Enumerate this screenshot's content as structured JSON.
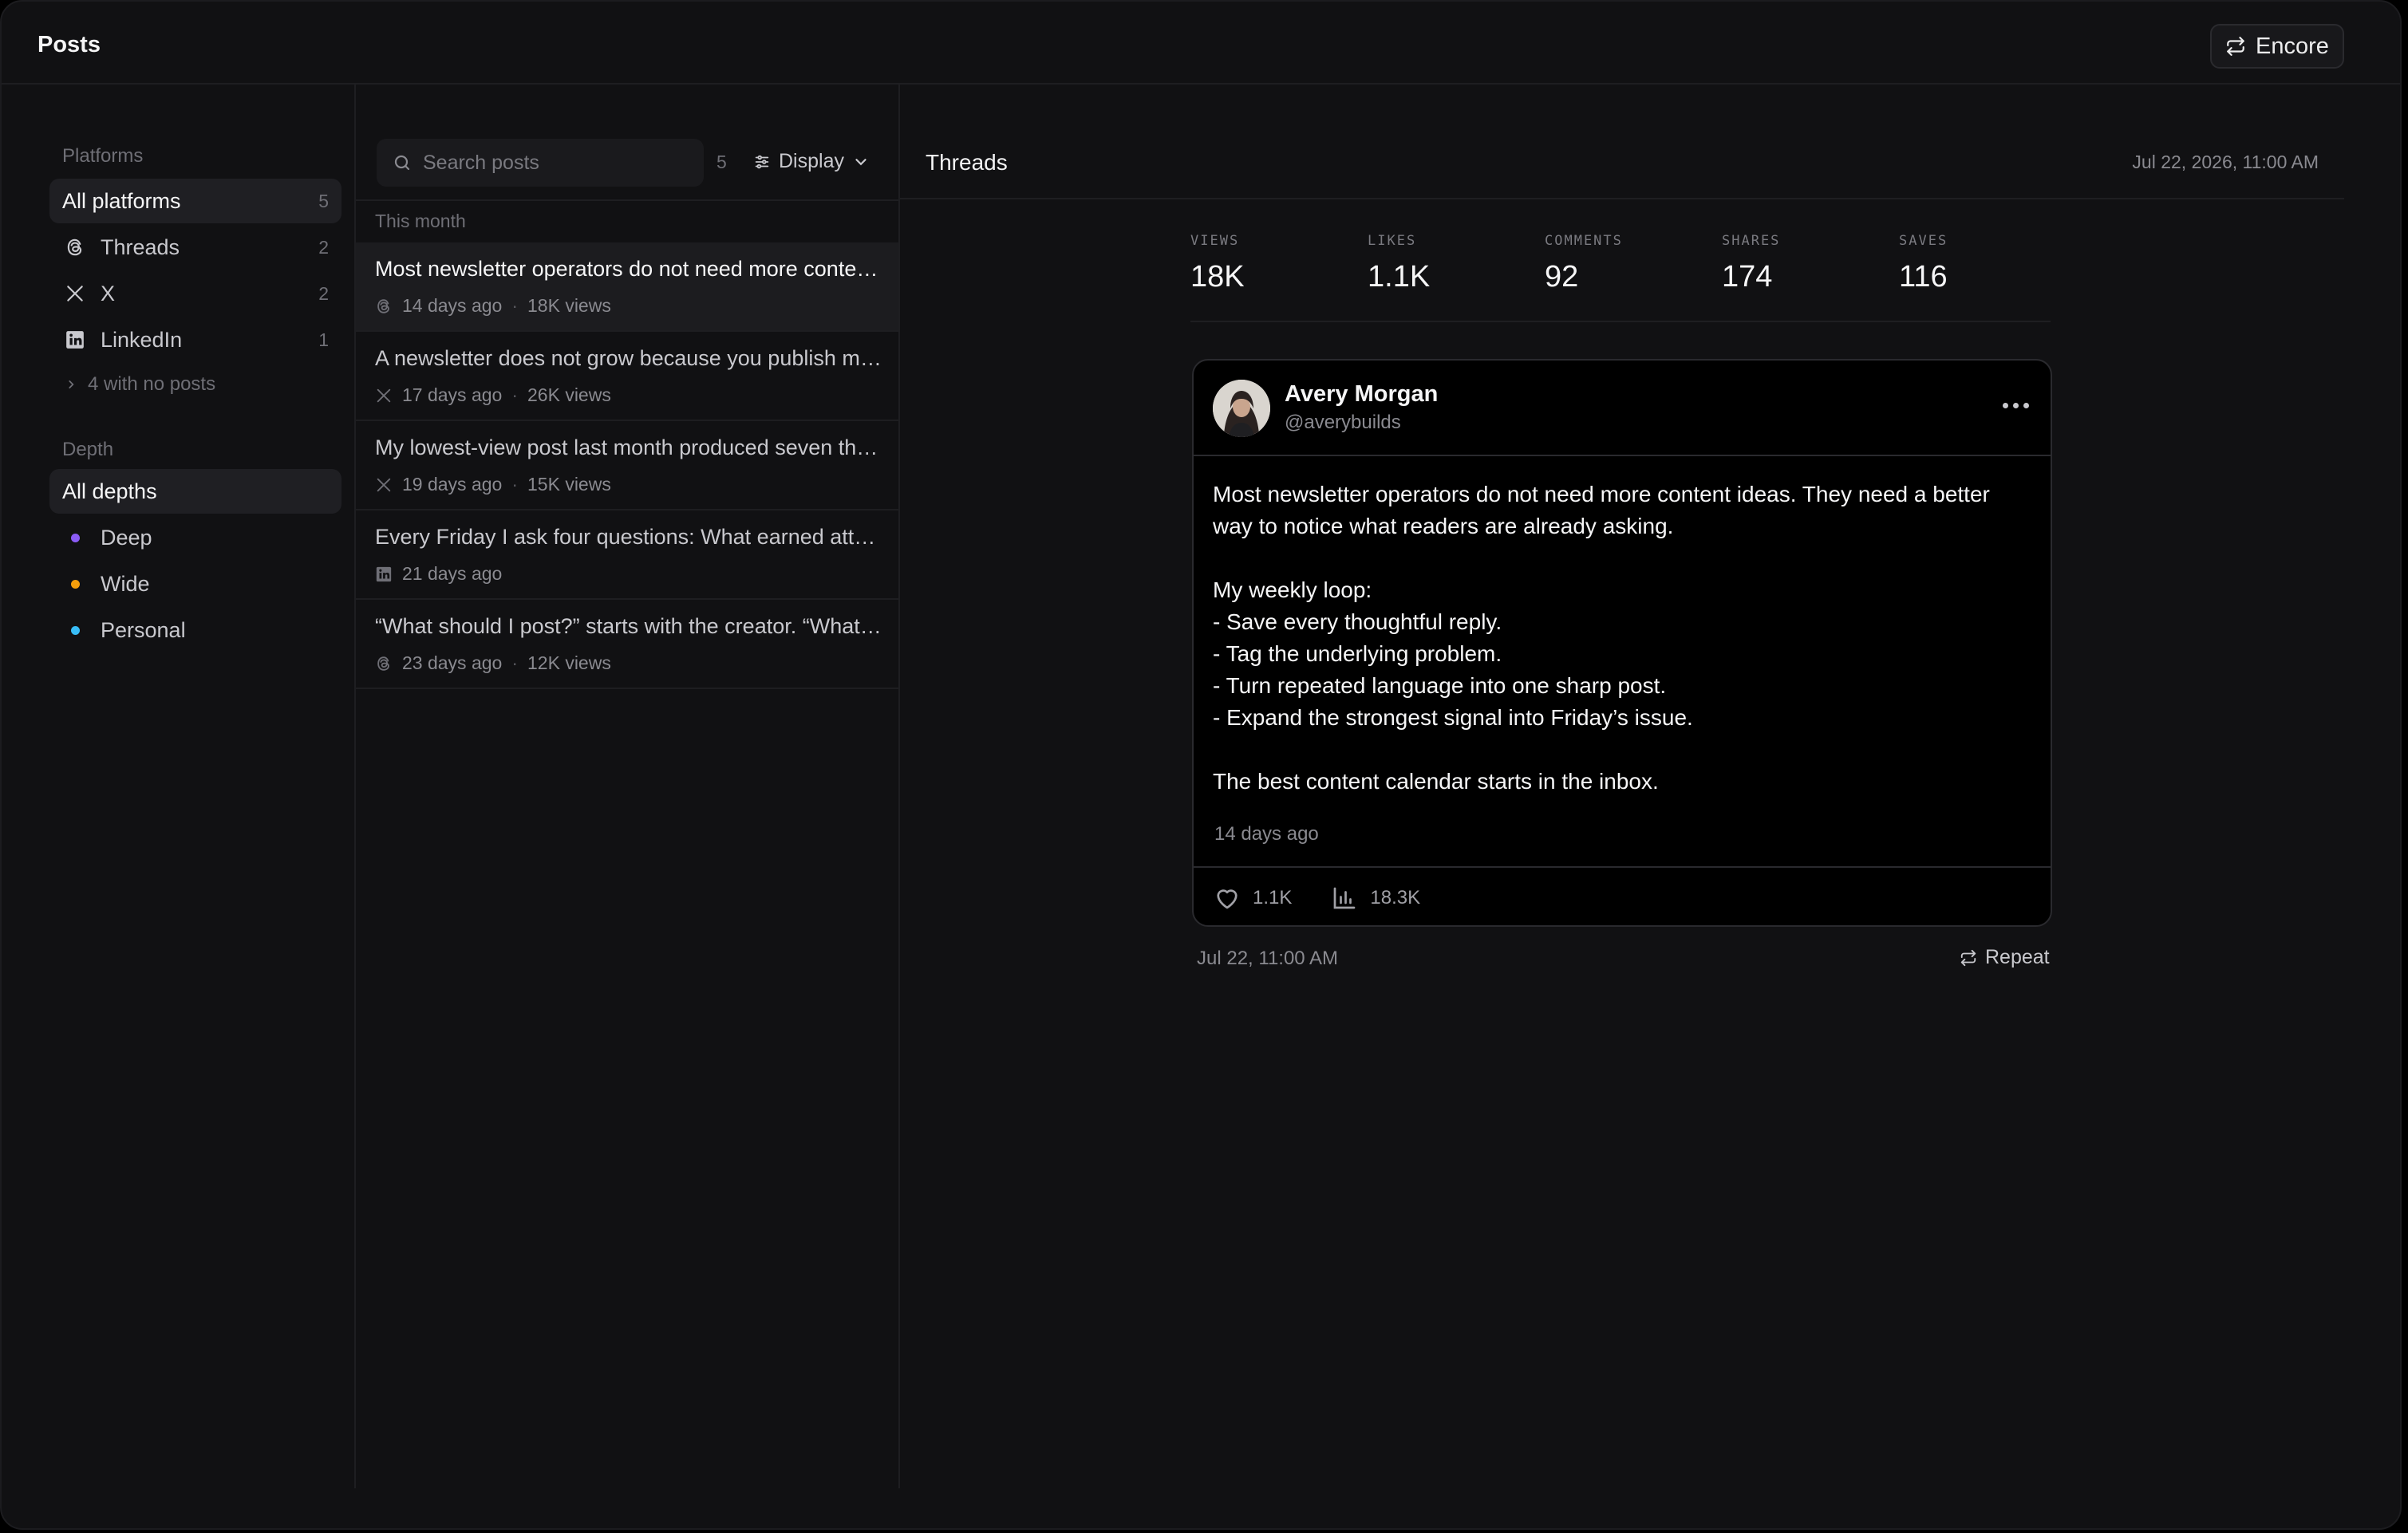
{
  "header": {
    "title": "Posts",
    "encore_label": "Encore"
  },
  "sidebar": {
    "platforms_label": "Platforms",
    "platforms": [
      {
        "label": "All platforms",
        "count": "5",
        "icon": "none"
      },
      {
        "label": "Threads",
        "count": "2",
        "icon": "threads-icon"
      },
      {
        "label": "X",
        "count": "2",
        "icon": "x-icon"
      },
      {
        "label": "LinkedIn",
        "count": "1",
        "icon": "linkedin-icon"
      }
    ],
    "more_label": "4 with no posts",
    "depth_label": "Depth",
    "depths": [
      {
        "label": "All depths"
      },
      {
        "label": "Deep",
        "color": "#8b5cf6"
      },
      {
        "label": "Wide",
        "color": "#f59e0b"
      },
      {
        "label": "Personal",
        "color": "#38bdf8"
      }
    ]
  },
  "list": {
    "search_placeholder": "Search posts",
    "count": "5",
    "display_label": "Display",
    "group_label": "This month",
    "posts": [
      {
        "title": "Most newsletter operators do not need more content ideas. They need a better way to notice",
        "age": "14 days ago",
        "views": "18K views",
        "platform": "threads"
      },
      {
        "title": "A newsletter does not grow because you publish more often.",
        "age": "17 days ago",
        "views": "26K views",
        "platform": "x"
      },
      {
        "title": "My lowest-view post last month produced seven thoughtful replies.",
        "age": "19 days ago",
        "views": "15K views",
        "platform": "x"
      },
      {
        "title": "Every Friday I ask four questions: What earned attention?",
        "age": "21 days ago",
        "views": "",
        "platform": "linkedin"
      },
      {
        "title": "“What should I post?” starts with the creator. “What do readers need?”",
        "age": "23 days ago",
        "views": "12K views",
        "platform": "threads"
      }
    ]
  },
  "detail": {
    "platform": "Threads",
    "date": "Jul 22, 2026, 11:00 AM",
    "stats": [
      {
        "key": "VIEWS",
        "value": "18K"
      },
      {
        "key": "LIKES",
        "value": "1.1K"
      },
      {
        "key": "COMMENTS",
        "value": "92"
      },
      {
        "key": "SHARES",
        "value": "174"
      },
      {
        "key": "SAVES",
        "value": "116"
      }
    ],
    "card": {
      "name": "Avery Morgan",
      "handle": "@averybuilds",
      "body": [
        "Most newsletter operators do not need more content ideas. They need a better",
        "way to notice what readers are already asking.",
        "",
        "My weekly loop:",
        "- Save every thoughtful reply.",
        "- Tag the underlying problem.",
        "- Turn repeated language into one sharp post.",
        "- Expand the strongest signal into Friday’s issue.",
        "",
        "The best content calendar starts in the inbox."
      ],
      "time": "14 days ago",
      "likes": "1.1K",
      "views": "18.3K"
    },
    "schedule_date": "Jul 22, 11:00 AM",
    "repeat_label": "Repeat"
  }
}
